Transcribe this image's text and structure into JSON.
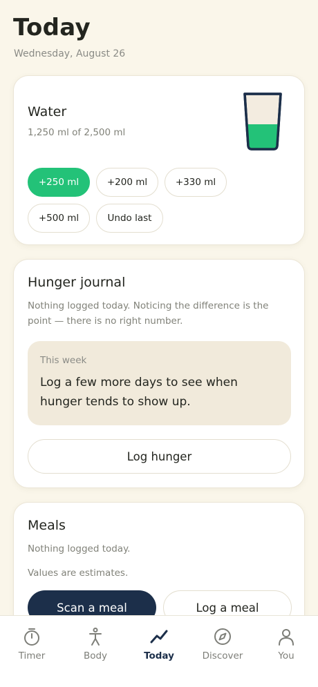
{
  "header": {
    "title": "Today",
    "date": "Wednesday, August 26"
  },
  "water": {
    "title": "Water",
    "progress_text": "1,250 ml of 2,500 ml",
    "fill_fraction": 0.5,
    "icon": "water-glass-icon",
    "fill_color": "#23c278",
    "buttons": [
      "+250 ml",
      "+200 ml",
      "+330 ml",
      "+500 ml",
      "Undo last"
    ]
  },
  "hunger": {
    "title": "Hunger journal",
    "description": "Nothing logged today. Noticing the difference is the point — there is no right number.",
    "week_label": "This week",
    "week_text": "Log a few more days to see when hunger tends to show up.",
    "log_button": "Log hunger"
  },
  "meals": {
    "title": "Meals",
    "status": "Nothing logged today.",
    "note": "Values are estimates.",
    "scan_button": "Scan a meal",
    "log_button": "Log a meal"
  },
  "tabbar": {
    "active": "Today",
    "tabs": [
      {
        "label": "Timer",
        "icon": "stopwatch-icon"
      },
      {
        "label": "Body",
        "icon": "person-icon"
      },
      {
        "label": "Today",
        "icon": "trend-icon"
      },
      {
        "label": "Discover",
        "icon": "compass-icon"
      },
      {
        "label": "You",
        "icon": "user-icon"
      }
    ]
  },
  "colors": {
    "background": "#faf6ea",
    "accent_green": "#23c278",
    "navy": "#1c2f4a"
  }
}
